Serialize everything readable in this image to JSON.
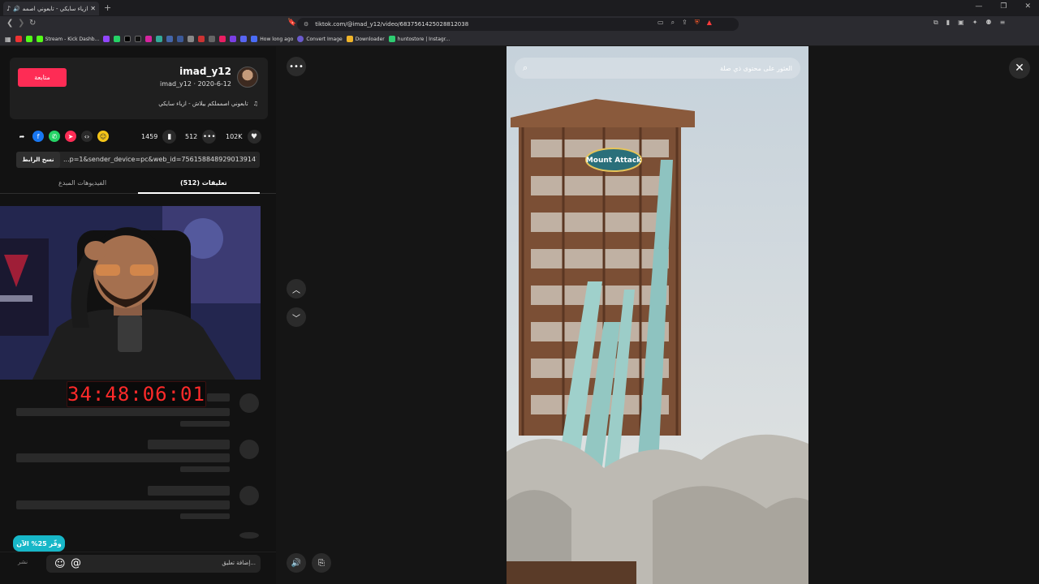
{
  "browser": {
    "tab_title": "ازياء سايكي - تابعوني اصمملكم...",
    "new_tab": "+",
    "url": "tiktok.com/@imad_y12/video/6837561425028812038",
    "window_controls": [
      "—",
      "❐",
      "✕"
    ],
    "bookmarks": [
      "Stream - Kick Dashb...",
      "How long ago",
      "Convert Image",
      "Downloader",
      "huntostore | Instagr..."
    ]
  },
  "author": {
    "username": "imad_y12",
    "subline": "imad_y12 · 2020-6-12",
    "follow_label": "متابعة",
    "music": "تابعوني اصمملكم بيلاش - ازياء سايكي"
  },
  "stats": {
    "likes": "102K",
    "comments": "512",
    "saves": "1459"
  },
  "share_link": {
    "copy_label": "نسخ الرابط",
    "link_text": "...p=1&sender_device=pc&web_id=7561588489290139147"
  },
  "tabs": {
    "comments": "تعليقات (512)",
    "creator_videos": "الفيديوهات المبدع"
  },
  "overlay": {
    "timer": "34:48:06:01",
    "save_badge": "وفّر 25% الآن"
  },
  "comment_bar": {
    "placeholder": "إضافة تعليق...",
    "post_label": "نشر"
  },
  "video": {
    "search_placeholder": "العثور على محتوى ذي صلة",
    "sign_text": "Mount Attack"
  },
  "colors": {
    "accent": "#fe2c55",
    "badge": "#17b7c8",
    "timer": "#ff2a2a"
  }
}
